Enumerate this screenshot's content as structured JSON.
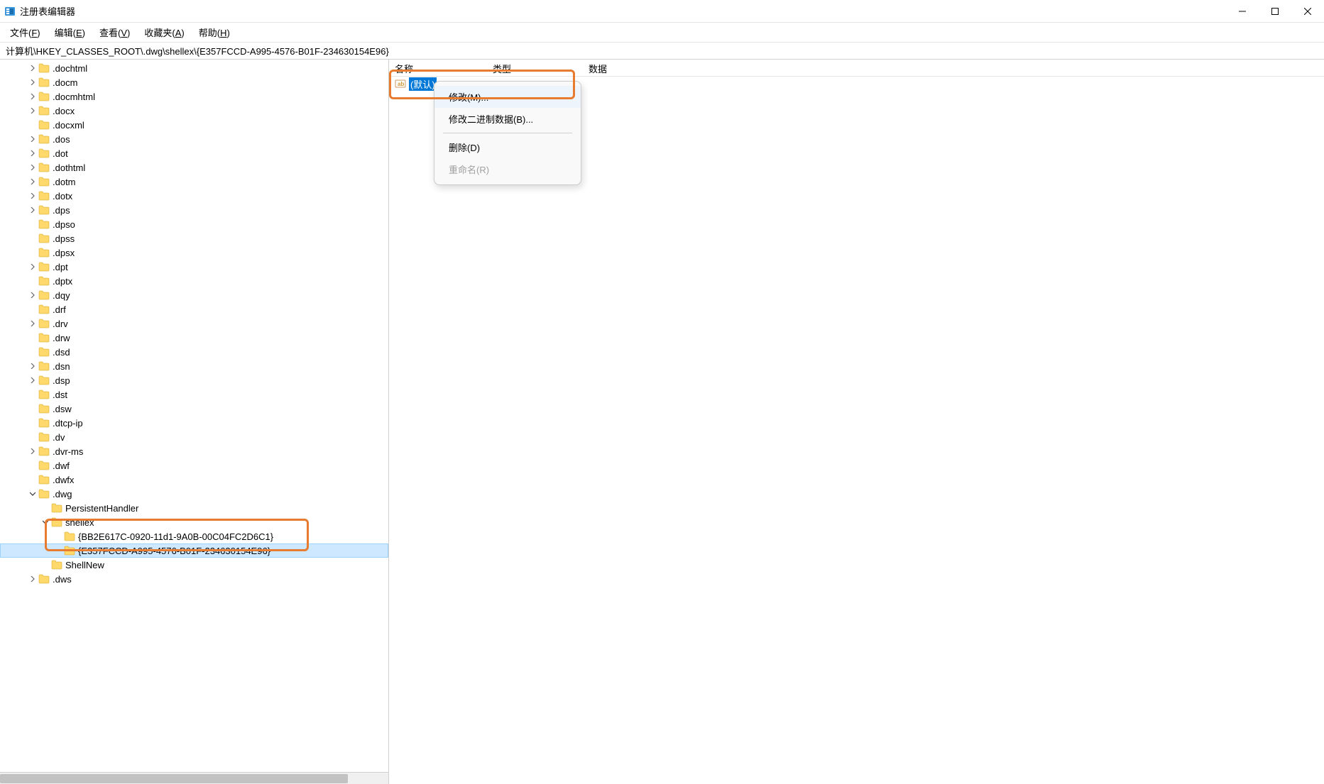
{
  "window": {
    "title": "注册表编辑器"
  },
  "menu": {
    "file": "文件(F)",
    "edit": "编辑(E)",
    "view": "查看(V)",
    "favorites": "收藏夹(A)",
    "help": "帮助(H)"
  },
  "address": "计算机\\HKEY_CLASSES_ROOT\\.dwg\\shellex\\{E357FCCD-A995-4576-B01F-234630154E96}",
  "tree": [
    {
      "indent": 2,
      "chevron": ">",
      "label": ".dochtml"
    },
    {
      "indent": 2,
      "chevron": ">",
      "label": ".docm"
    },
    {
      "indent": 2,
      "chevron": ">",
      "label": ".docmhtml"
    },
    {
      "indent": 2,
      "chevron": ">",
      "label": ".docx"
    },
    {
      "indent": 2,
      "chevron": "",
      "label": ".docxml"
    },
    {
      "indent": 2,
      "chevron": ">",
      "label": ".dos"
    },
    {
      "indent": 2,
      "chevron": ">",
      "label": ".dot"
    },
    {
      "indent": 2,
      "chevron": ">",
      "label": ".dothtml"
    },
    {
      "indent": 2,
      "chevron": ">",
      "label": ".dotm"
    },
    {
      "indent": 2,
      "chevron": ">",
      "label": ".dotx"
    },
    {
      "indent": 2,
      "chevron": ">",
      "label": ".dps"
    },
    {
      "indent": 2,
      "chevron": "",
      "label": ".dpso"
    },
    {
      "indent": 2,
      "chevron": "",
      "label": ".dpss"
    },
    {
      "indent": 2,
      "chevron": "",
      "label": ".dpsx"
    },
    {
      "indent": 2,
      "chevron": ">",
      "label": ".dpt"
    },
    {
      "indent": 2,
      "chevron": "",
      "label": ".dptx"
    },
    {
      "indent": 2,
      "chevron": ">",
      "label": ".dqy"
    },
    {
      "indent": 2,
      "chevron": "",
      "label": ".drf"
    },
    {
      "indent": 2,
      "chevron": ">",
      "label": ".drv"
    },
    {
      "indent": 2,
      "chevron": "",
      "label": ".drw"
    },
    {
      "indent": 2,
      "chevron": "",
      "label": ".dsd"
    },
    {
      "indent": 2,
      "chevron": ">",
      "label": ".dsn"
    },
    {
      "indent": 2,
      "chevron": ">",
      "label": ".dsp"
    },
    {
      "indent": 2,
      "chevron": "",
      "label": ".dst"
    },
    {
      "indent": 2,
      "chevron": "",
      "label": ".dsw"
    },
    {
      "indent": 2,
      "chevron": "",
      "label": ".dtcp-ip"
    },
    {
      "indent": 2,
      "chevron": "",
      "label": ".dv"
    },
    {
      "indent": 2,
      "chevron": ">",
      "label": ".dvr-ms"
    },
    {
      "indent": 2,
      "chevron": "",
      "label": ".dwf"
    },
    {
      "indent": 2,
      "chevron": "",
      "label": ".dwfx"
    },
    {
      "indent": 2,
      "chevron": "v",
      "label": ".dwg"
    },
    {
      "indent": 3,
      "chevron": "",
      "label": "PersistentHandler"
    },
    {
      "indent": 3,
      "chevron": "v",
      "label": "shellex"
    },
    {
      "indent": 4,
      "chevron": "",
      "label": "{BB2E617C-0920-11d1-9A0B-00C04FC2D6C1}"
    },
    {
      "indent": 4,
      "chevron": "",
      "label": "{E357FCCD-A995-4576-B01F-234630154E96}",
      "selected": true
    },
    {
      "indent": 3,
      "chevron": "",
      "label": "ShellNew"
    },
    {
      "indent": 2,
      "chevron": ">",
      "label": ".dws"
    }
  ],
  "list": {
    "columns": {
      "name": "名称",
      "type": "类型",
      "data": "数据"
    },
    "rows": [
      {
        "name": "(默认)",
        "selected": true
      }
    ]
  },
  "context_menu": {
    "modify": "修改(M)...",
    "modify_binary": "修改二进制数据(B)...",
    "delete": "删除(D)",
    "rename": "重命名(R)"
  }
}
